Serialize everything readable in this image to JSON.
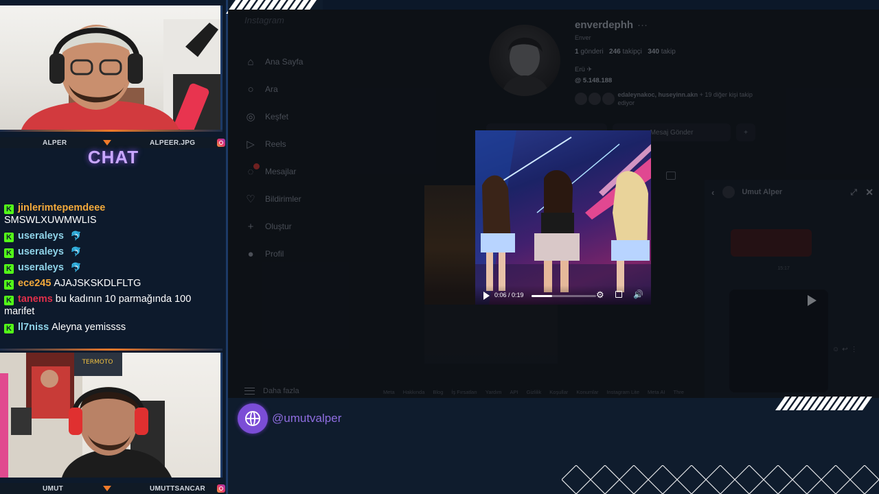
{
  "overlay": {
    "cam1": {
      "left_name": "ALPER",
      "right_name": "ALPEER.JPG"
    },
    "cam2": {
      "left_name": "UMUT",
      "right_name": "UMUTTSANCAR"
    },
    "chat_title": "CHAT",
    "handle": "@umutvalper",
    "accent_color": "#7b4dd6",
    "kick_color": "#53fc18"
  },
  "chat": {
    "messages": [
      {
        "user": "jinlerimtepemdeee",
        "color": "#f2a93b",
        "text": "SMSWLXUWMWLIS",
        "newline": true
      },
      {
        "user": "useraleys",
        "color": "#8fd3e8",
        "text": "",
        "emote": "🐬"
      },
      {
        "user": "useraleys",
        "color": "#8fd3e8",
        "text": "",
        "emote": "🐬"
      },
      {
        "user": "useraleys",
        "color": "#8fd3e8",
        "text": "",
        "emote": "🐬"
      },
      {
        "user": "ece245",
        "color": "#f2a93b",
        "text": "AJAJSKSKDLFLTG"
      },
      {
        "user": "tanems",
        "color": "#e0304a",
        "text": "bu kadının 10 parmağında 100 marifet"
      },
      {
        "user": "ll7niss",
        "color": "#8fd3e8",
        "text": "Aleyna yemissss"
      }
    ]
  },
  "instagram": {
    "logo_partial": "Instagram",
    "nav": [
      {
        "label": "Ana Sayfa",
        "icon": "home-icon"
      },
      {
        "label": "Ara",
        "icon": "search-icon"
      },
      {
        "label": "Keşfet",
        "icon": "compass-icon"
      },
      {
        "label": "Reels",
        "icon": "reels-icon"
      },
      {
        "label": "Mesajlar",
        "icon": "messenger-icon",
        "badge": "1"
      },
      {
        "label": "Bildirimler",
        "icon": "heart-icon"
      },
      {
        "label": "Oluştur",
        "icon": "plus-icon"
      },
      {
        "label": "Profil",
        "icon": "profile-avatar-icon"
      }
    ],
    "more_label": "Daha fazla",
    "profile": {
      "username": "enverdephh",
      "full_name": "Enver",
      "posts": "1",
      "posts_label": "gönderi",
      "followers": "246",
      "followers_label": "takipçi",
      "following": "340",
      "following_label": "takip",
      "bio": "Erü ✈",
      "link": "5.148.188",
      "followed_by": "edaleynakoc, huseyinn.akn",
      "followed_by_rest": "+ 19 diğer kişi takip ediyor",
      "message_button": "Mesaj Gönder"
    },
    "dm": {
      "name": "Umut Alper",
      "time": "15:17"
    },
    "footer": [
      "Meta",
      "Hakkında",
      "Blog",
      "İş Fırsatları",
      "Yardım",
      "API",
      "Gizlilik",
      "Koşullar",
      "Konumlar",
      "Instagram Lite",
      "Meta AI",
      "Thre"
    ]
  },
  "video": {
    "time": "0:06 / 0:19",
    "progress": 0.32
  }
}
